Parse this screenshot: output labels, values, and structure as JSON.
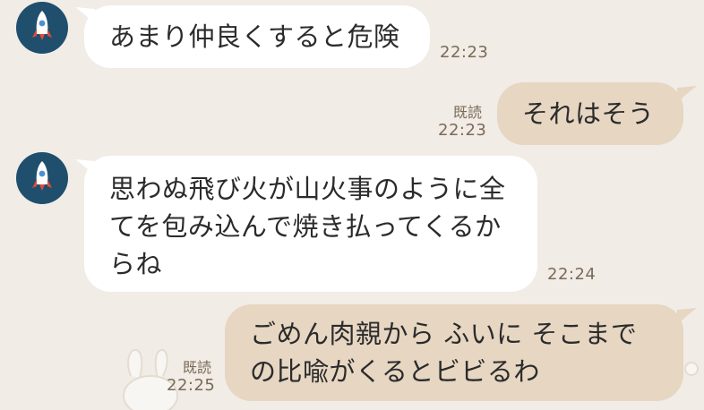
{
  "messages": [
    {
      "side": "in",
      "text": "あまり仲良くすると危険",
      "time": "22:23"
    },
    {
      "side": "out",
      "text": "それはそう",
      "read": "既読",
      "time": "22:23"
    },
    {
      "side": "in",
      "lines": [
        "思わぬ飛び火が山火事のように全",
        "てを包み込んで焼き払ってくるか",
        "らね"
      ],
      "time": "22:24"
    },
    {
      "side": "out",
      "lines": [
        "ごめん肉親から ふいに そこまで",
        "の比喩がくるとビビるわ"
      ],
      "read": "既読",
      "time": "22:25"
    }
  ],
  "avatar_icon": "rocket-icon",
  "colors": {
    "background": "#f1ece6",
    "incoming_bubble": "#ffffff",
    "outgoing_bubble": "#e6d6c2",
    "avatar_bg": "#1f4f6d",
    "meta_text": "#7a6a57"
  }
}
